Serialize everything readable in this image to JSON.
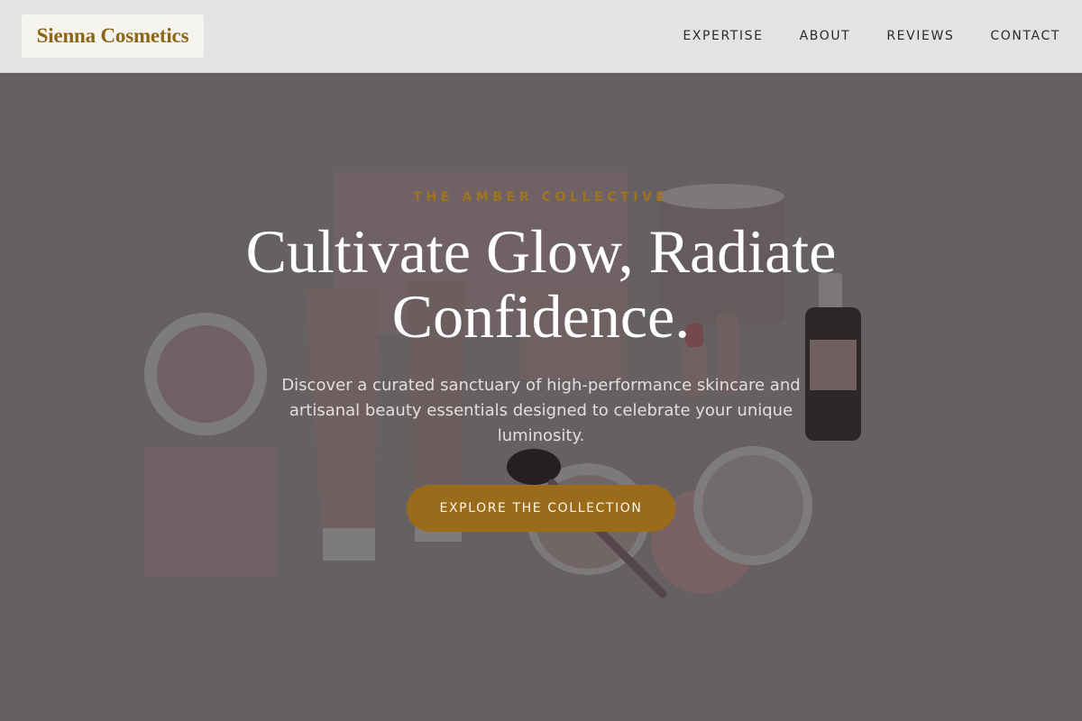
{
  "brand": {
    "name": "Sienna Cosmetics"
  },
  "nav": {
    "items": [
      "EXPERTISE",
      "ABOUT",
      "REVIEWS",
      "CONTACT"
    ]
  },
  "hero": {
    "eyebrow": "THE AMBER COLLECTIVE",
    "headline": "Cultivate Glow, Radiate Confidence.",
    "subtext": "Discover a curated sanctuary of high-performance skincare and artisanal beauty essentials designed to celebrate your unique luminosity.",
    "cta_label": "EXPLORE THE COLLECTION",
    "background_image": "flat-lay of pink cosmetic product mockups"
  },
  "colors": {
    "accent": "#9a6b1b",
    "header_bg": "#e3e3e3",
    "hero_overlay": "#6d696a"
  }
}
